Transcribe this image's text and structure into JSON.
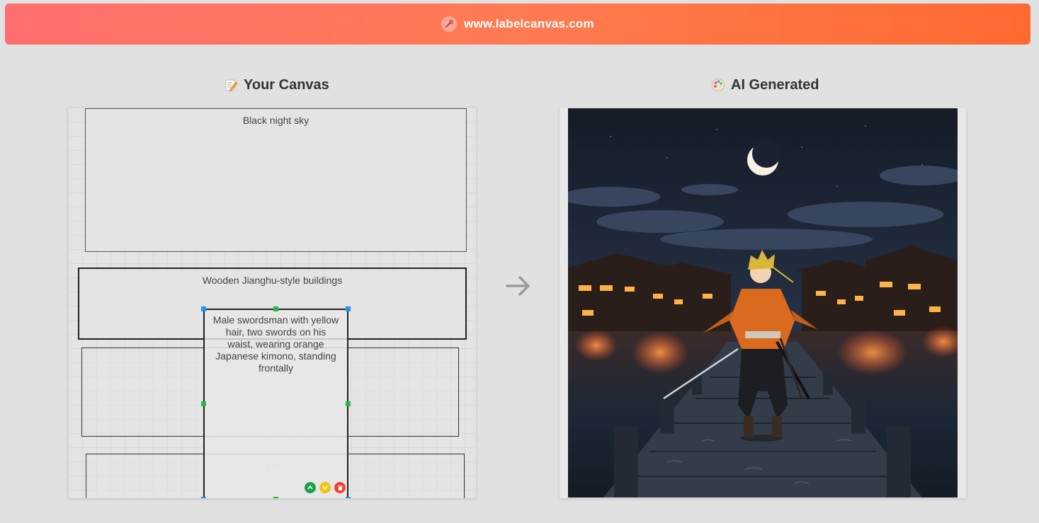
{
  "banner": {
    "url": "www.labelcanvas.com",
    "icon": "wrench-icon",
    "colors": [
      "#ff6f6f",
      "#ff6a30"
    ]
  },
  "left_heading": {
    "icon": "pencil-memo-icon",
    "title": "Your Canvas"
  },
  "right_heading": {
    "icon": "palette-icon",
    "title": "AI Generated"
  },
  "canvas": {
    "regions": [
      {
        "id": "sky",
        "label": "Black night sky"
      },
      {
        "id": "buildings",
        "label": "Wooden Jianghu-style buildings"
      },
      {
        "id": "swordsman",
        "label": "Male swordsman with yellow hair, two swords on his waist, wearing orange Japanese kimono, standing frontally"
      },
      {
        "id": "pier",
        "label": "pier"
      }
    ],
    "selected_region": "swordsman",
    "controls": [
      "move-up",
      "move-down",
      "delete"
    ]
  },
  "arrow_icon": "right-arrow-icon",
  "generated_image": {
    "subject": "anime swordsman on wooden pier at night with crescent moon and lit buildings"
  }
}
